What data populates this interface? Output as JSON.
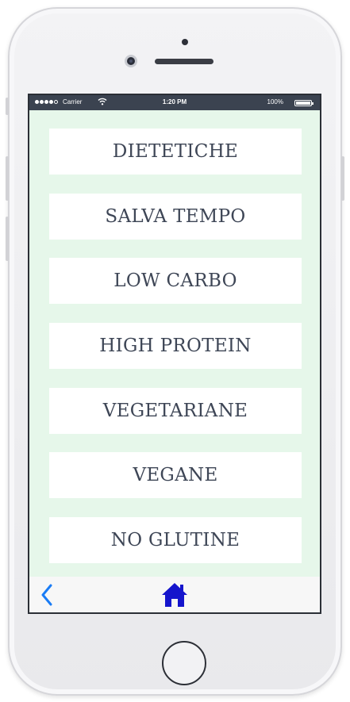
{
  "status_bar": {
    "carrier": "Carrier",
    "time": "1:20 PM",
    "battery": "100%"
  },
  "menu": {
    "items": [
      {
        "label": "DIETETICHE"
      },
      {
        "label": "SALVA TEMPO"
      },
      {
        "label": "LOW CARBO"
      },
      {
        "label": "HIGH PROTEIN"
      },
      {
        "label": "VEGETARIANE"
      },
      {
        "label": "VEGANE"
      },
      {
        "label": "NO GLUTINE"
      }
    ]
  },
  "bottom_bar": {
    "back_icon": "chevron-left-icon",
    "home_icon": "home-icon"
  },
  "colors": {
    "background": "#e6f7ea",
    "status_bar": "#3b4350",
    "item_text": "#3e4656",
    "back_icon": "#1a7cf5",
    "home_icon": "#1515cc"
  }
}
